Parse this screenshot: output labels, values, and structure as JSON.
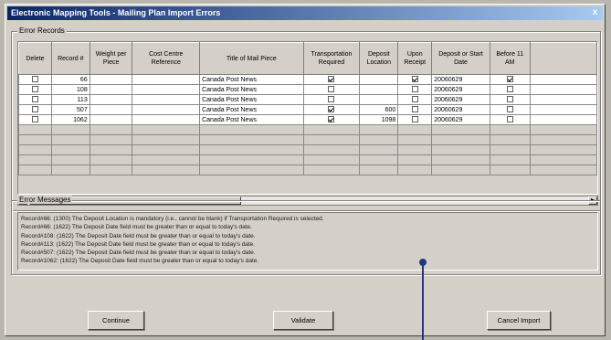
{
  "window": {
    "title": "Electronic Mapping Tools - Mailing Plan Import Errors",
    "close_glyph": "x"
  },
  "records_group": {
    "label": "Error Records",
    "columns": [
      "Delete",
      "Record #",
      "Weight per Piece",
      "Cost Centre Reference",
      "Title of Mail Piece",
      "Transportation Required",
      "Deposit Location",
      "Upon Receipt",
      "Deposit or Start Date",
      "Before 11 AM"
    ],
    "rows": [
      {
        "delete": false,
        "record": "66",
        "weight": "",
        "cost_centre": "",
        "title": "Canada Post News",
        "transport": true,
        "location": "",
        "upon_receipt": true,
        "date": "20060629",
        "before_11": true
      },
      {
        "delete": false,
        "record": "108",
        "weight": "",
        "cost_centre": "",
        "title": "Canada Post News",
        "transport": false,
        "location": "",
        "upon_receipt": false,
        "date": "20060629",
        "before_11": false
      },
      {
        "delete": false,
        "record": "113",
        "weight": "",
        "cost_centre": "",
        "title": "Canada Post News",
        "transport": false,
        "location": "",
        "upon_receipt": false,
        "date": "20060629",
        "before_11": false
      },
      {
        "delete": false,
        "record": "507",
        "weight": "",
        "cost_centre": "",
        "title": "Canada Post News",
        "transport": true,
        "location": "600",
        "upon_receipt": false,
        "date": "20060629",
        "before_11": false
      },
      {
        "delete": false,
        "record": "1062",
        "weight": "",
        "cost_centre": "",
        "title": "Canada Post News",
        "transport": true,
        "location": "1098",
        "upon_receipt": false,
        "date": "20060629",
        "before_11": false
      }
    ],
    "scroll_left": "◄",
    "scroll_right": "►"
  },
  "messages_group": {
    "label": "Error Messages",
    "lines": [
      "Record#66: (1300) The Deposit Location is mandatory (i.e., cannot be blank) if Transportation Required is selected.",
      "Record#66: (1622) The Deposit Date field must be greater than or equal to today's date.",
      "Record#108: (1622) The Deposit Date field must be greater than or equal to today's date.",
      "Record#113: (1622) The Deposit Date field must be greater than or equal to today's date.",
      "Record#507: (1622) The Deposit Date field must be greater than or equal to today's date.",
      "Record#1062: (1622) The Deposit Date field must be greater than or equal to today's date."
    ]
  },
  "buttons": {
    "continue": "Continue",
    "validate": "Validate",
    "cancel": "Cancel Import"
  }
}
